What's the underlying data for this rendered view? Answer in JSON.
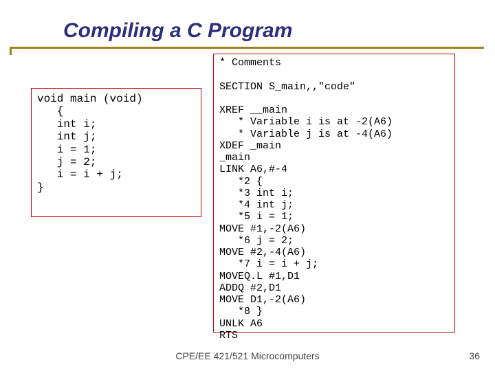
{
  "title": "Compiling a C Program",
  "left_code": "void main (void)\n   {\n   int i;\n   int j;\n   i = 1;\n   j = 2;\n   i = i + j;\n}",
  "right_code": "* Comments\n\nSECTION S_main,,\"code\"\n\nXREF __main\n   * Variable i is at -2(A6)\n   * Variable j is at -4(A6)\nXDEF _main\n_main\nLINK A6,#-4\n   *2 {\n   *3 int i;\n   *4 int j;\n   *5 i = 1;\nMOVE #1,-2(A6)\n   *6 j = 2;\nMOVE #2,-4(A6)\n   *7 i = i + j;\nMOVEQ.L #1,D1\nADDQ #2,D1\nMOVE D1,-2(A6)\n   *8 }\nUNLK A6\nRTS",
  "footer": "CPE/EE 421/521 Microcomputers",
  "page": "36"
}
